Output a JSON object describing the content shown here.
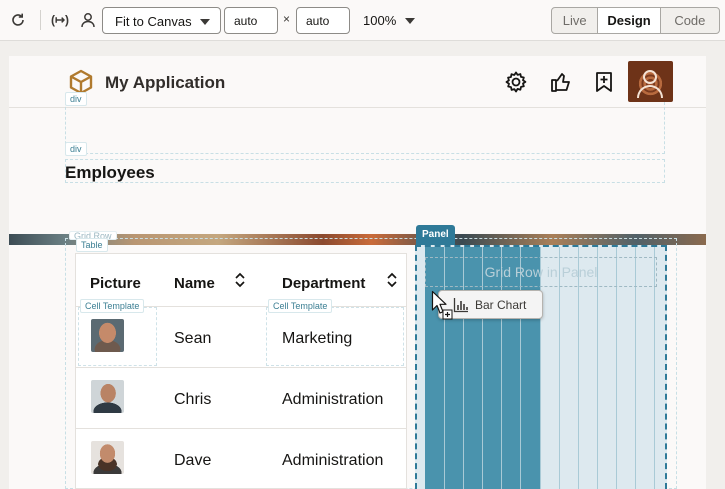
{
  "toolbar": {
    "fit_label": "Fit to Canvas",
    "width_value": "auto",
    "height_value": "auto",
    "times_symbol": "×",
    "zoom": "100%",
    "modes": [
      "Live",
      "Design",
      "Code"
    ],
    "active_mode": "Design"
  },
  "app": {
    "title": "My Application"
  },
  "design_labels": {
    "div1": "div",
    "div2": "div",
    "grid_row": "Grid Row",
    "table": "Table",
    "cell_template_1": "Cell Template",
    "cell_template_2": "Cell Template",
    "panel": "Panel",
    "grid_row_in_panel": "Grid Row in Panel"
  },
  "page": {
    "heading": "Employees"
  },
  "table": {
    "headers": [
      "Picture",
      "Name",
      "Department"
    ],
    "rows": [
      {
        "name": "Sean",
        "department": "Marketing"
      },
      {
        "name": "Chris",
        "department": "Administration"
      },
      {
        "name": "Dave",
        "department": "Administration"
      }
    ]
  },
  "drag_item": {
    "label": "Bar Chart"
  },
  "colors": {
    "accent": "#2f7a98",
    "panel_fill": "#4a93ad",
    "panel_bg": "#dde9ef",
    "brand": "#b07a2e"
  }
}
